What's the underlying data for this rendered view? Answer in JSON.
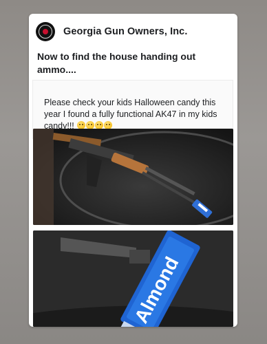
{
  "post": {
    "page_name": "Georgia Gun Owners, Inc.",
    "text": "Now to find the house handing out ammo....",
    "quote": "Please check your kids Halloween candy this year I found a fully functional AK47 in my kids candy!!!",
    "quote_emojis": [
      "frowning-face-icon",
      "frowning-face-icon",
      "frowning-face-icon",
      "frowning-face-icon"
    ]
  },
  "photos": [
    {
      "name": "rifle-on-table-photo"
    },
    {
      "name": "almond-joy-candy-photo"
    }
  ],
  "candy_label": "Almond"
}
